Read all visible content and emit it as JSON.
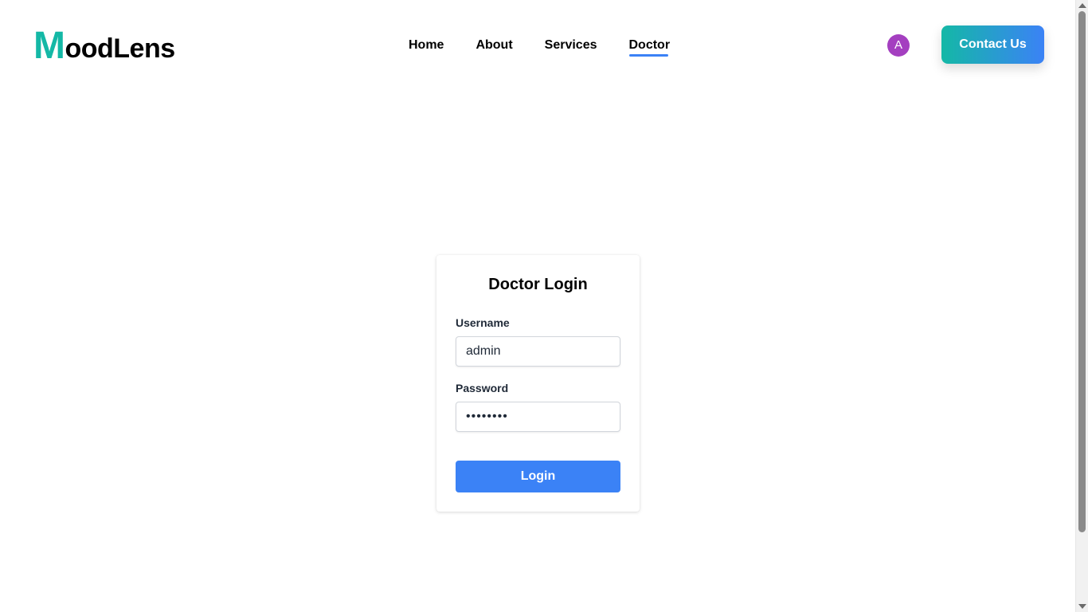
{
  "header": {
    "logo_first": "M",
    "logo_rest": "oodLens",
    "nav": {
      "home": "Home",
      "about": "About",
      "services": "Services",
      "doctor": "Doctor"
    },
    "active_nav": "Doctor",
    "avatar_initial": "A",
    "contact_label": "Contact Us"
  },
  "login": {
    "title": "Doctor Login",
    "username_label": "Username",
    "username_value": "admin",
    "password_label": "Password",
    "password_value": "••••••••",
    "submit_label": "Login"
  },
  "colors": {
    "accent": "#3b82f6",
    "brand_teal": "#14b8a6",
    "avatar_bg": "#a43fc0"
  },
  "icons": {
    "scroll_up": "scroll-up-arrow-icon",
    "scroll_down": "scroll-down-arrow-icon"
  }
}
